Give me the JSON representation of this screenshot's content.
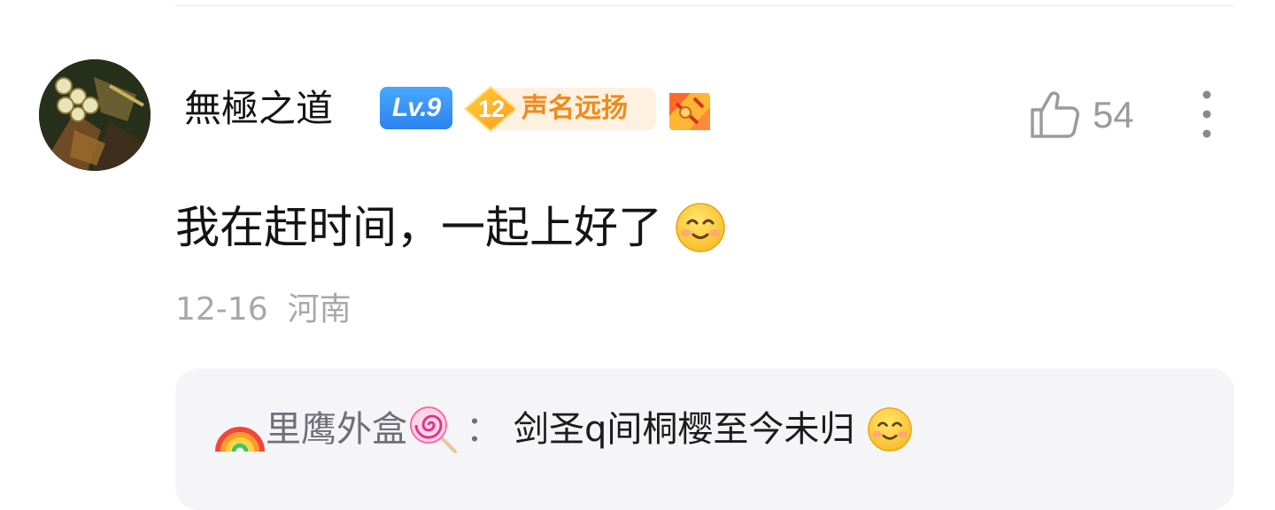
{
  "comment": {
    "username": "無極之道",
    "level_badge": "Lv.9",
    "fame_level": "12",
    "fame_title": "声名远扬",
    "like_count": "54",
    "text": "我在赶时间，一起上好了",
    "date": "12-16",
    "location": "河南"
  },
  "reply": {
    "username": "里鹰外盒",
    "colon": "：",
    "text": "剑圣q间桐樱至今未归"
  },
  "icons": {
    "like": "thumbs-up-icon",
    "more": "more-vertical-icon",
    "emoji": "smile-emoji-icon",
    "rainbow": "rainbow-emoji-icon",
    "lollipop": "lollipop-emoji-icon",
    "medal": "medal-badge-icon"
  },
  "colors": {
    "level_badge": "#2b82f0",
    "fame_text": "#f08a1c",
    "fame_bg": "#fff1df",
    "secondary_text": "#a8a8a8",
    "reply_bg": "#f5f5f7"
  }
}
